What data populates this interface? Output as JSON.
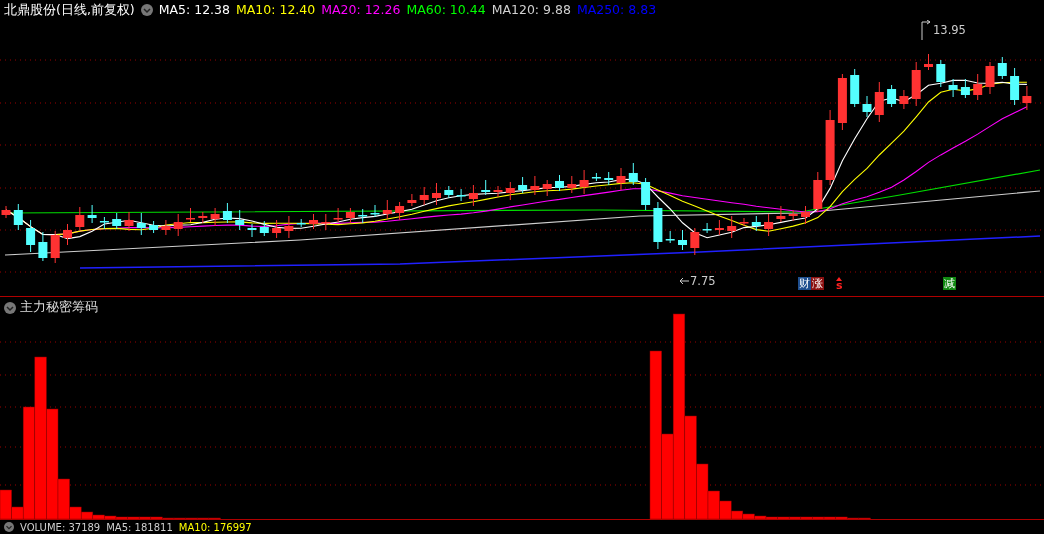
{
  "header": {
    "title": "北鼎股份(日线,前复权)",
    "ma_readings": [
      {
        "label": "MA5: 12.38",
        "color": "#ffffff"
      },
      {
        "label": "MA10: 12.40",
        "color": "#ffff00"
      },
      {
        "label": "MA20: 12.26",
        "color": "#ff00ff"
      },
      {
        "label": "MA60: 10.44",
        "color": "#00ff00"
      },
      {
        "label": "MA120: 9.88",
        "color": "#d0d0d0"
      },
      {
        "label": "MA250: 8.83",
        "color": "#0000ff"
      }
    ]
  },
  "price_chart": {
    "high_label": "13.95",
    "low_label": "7.75",
    "event_badges": [
      {
        "text": "财",
        "kind": "box",
        "color": "#1f4f8f"
      },
      {
        "text": "涨",
        "kind": "box",
        "color": "#8b1010"
      },
      {
        "text": "s",
        "kind": "arrow",
        "color": "#ff2020"
      },
      {
        "text": "减",
        "kind": "box",
        "color": "#118811"
      }
    ]
  },
  "indicator_panel": {
    "title": "主力秘密筹码"
  },
  "volume_legend": [
    {
      "label": "VOLUME: 37189",
      "color": "#d0d0d0"
    },
    {
      "label": "MA5: 181811",
      "color": "#d0d0d0"
    },
    {
      "label": "MA10: 176997",
      "color": "#ffff00"
    }
  ]
}
